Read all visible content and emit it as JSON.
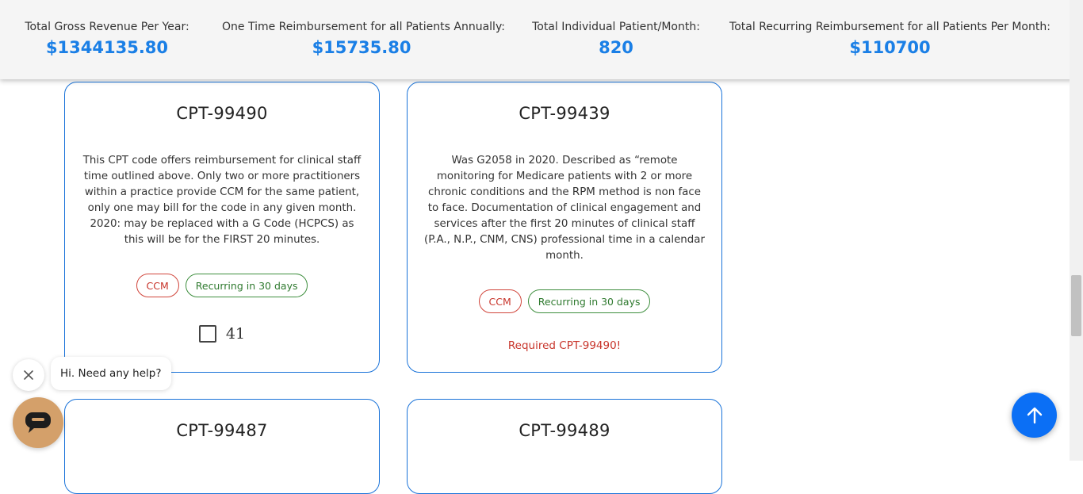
{
  "stats": [
    {
      "label": "Total Gross Revenue Per Year:",
      "value": "$1344135.80"
    },
    {
      "label": "One Time Reimbursement for all Patients Annually:",
      "value": "$15735.80"
    },
    {
      "label": "Total Individual Patient/Month:",
      "value": "820"
    },
    {
      "label": "Total Recurring Reimbursement for all Patients Per Month:",
      "value": "$110700"
    }
  ],
  "cards": [
    {
      "title": "CPT-99490",
      "description": "This CPT code offers reimbursement for clinical staff time outlined above. Only two or more practitioners within a practice provide CCM for the same patient, only one may bill for the code in any given month. 2020: may be replaced with a G Code (HCPCS) as this will be for the FIRST 20 minutes.",
      "tag_category": "CCM",
      "tag_recurrence": "Recurring in 30 days",
      "quantity": "41"
    },
    {
      "title": "CPT-99439",
      "description": "Was G2058 in 2020. Described as “remote monitoring for Medicare patients with 2 or more chronic conditions and the RPM method is non face to face. Documentation of clinical engagement and services after the first 20 minutes of clinical staff (P.A., N.P., CNM, CNS) professional time in a calendar month.",
      "tag_category": "CCM",
      "tag_recurrence": "Recurring in 30 days",
      "required_message": "Required CPT-99490!"
    },
    {
      "title": "CPT-99487"
    },
    {
      "title": "CPT-99489"
    }
  ],
  "chat": {
    "greeting": "Hi. Need any help?",
    "close_icon": "close-icon",
    "launcher_icon": "chat-icon",
    "launcher_color": "#d4a06a"
  },
  "scroll_top_icon": "arrow-up-icon",
  "colors": {
    "accent": "#1a7fe6",
    "card_border": "#1a73d9",
    "tag_red": "#c8352b",
    "tag_green": "#2f7a2f",
    "scroll_button": "#0b6ff5"
  }
}
